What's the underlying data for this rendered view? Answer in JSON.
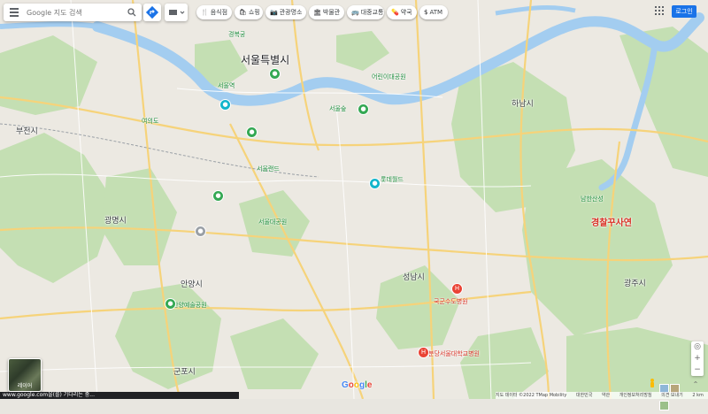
{
  "search": {
    "placeholder": "Google 지도 검색"
  },
  "chips": [
    {
      "icon": "🍴",
      "label": "음식점"
    },
    {
      "icon": "🛍",
      "label": "쇼핑"
    },
    {
      "icon": "📷",
      "label": "관광명소"
    },
    {
      "icon": "🏛",
      "label": "박물관"
    },
    {
      "icon": "🚌",
      "label": "대중교통"
    },
    {
      "icon": "💊",
      "label": "약국"
    },
    {
      "icon": "$",
      "label": "ATM"
    }
  ],
  "header": {
    "login_label": "로그인"
  },
  "map": {
    "cities": {
      "seoul": "서울특별시",
      "bucheon": "부천시",
      "gwangmyeong": "광명시",
      "anyang": "안양시",
      "gunpo": "군포시",
      "seongnam": "성남시",
      "hanam": "하남시",
      "gwangju": "광주시"
    },
    "poi": {
      "seoul_forest": "서울숲",
      "children_park": "어린이대공원",
      "seoul_station": "서울역",
      "yeouido": "여의도",
      "gyeongbok": "경복궁",
      "seoulland": "서울랜드",
      "bundang_univ": "분당서울대학교병원",
      "gukgun_hospital": "국군수도병원",
      "lotte_tower": "롯데월드",
      "seoul_grand_park": "서울대공원",
      "anyang_art_park": "안양예술공원",
      "namhansanseong": "남한산성"
    },
    "overlay_red": "경찰꾸사연"
  },
  "satellite": {
    "label": "레이어"
  },
  "footer": {
    "loading": "www.google.com을(를) 기다리는 중...",
    "attribution": [
      "지도 데이터 ©2022 TMap Mobility",
      "대한민국",
      "약관",
      "개인정보처리방침",
      "의견 보내기",
      "2 km"
    ]
  },
  "colors": {
    "river": "#a3cdf0",
    "green": "#bfdcae",
    "urban": "#eae7e1",
    "road_major": "#f6d37a",
    "accent": "#1a73e8"
  }
}
